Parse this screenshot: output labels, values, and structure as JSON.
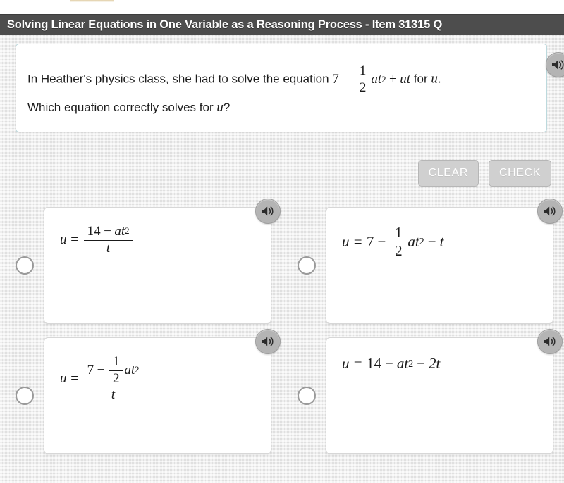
{
  "titlebar": {
    "title": "Solving Linear Equations in One Variable as a Reasoning Process - Item 31315   Q"
  },
  "question": {
    "line1_before": "In Heather's physics class, she had to solve the equation",
    "line1_eq_lhs": "7",
    "line1_eq_rel": "=",
    "line1_frac_num": "1",
    "line1_frac_den": "2",
    "line1_term1": "at",
    "line1_term1_exp": "2",
    "line1_plus": "+",
    "line1_term2": "ut",
    "line1_after": "for",
    "line1_var": "u",
    "line1_period": ".",
    "line2_before": "Which equation correctly solves for",
    "line2_var": "u",
    "line2_after": "?",
    "speaker_icon": "speaker-icon"
  },
  "toolbar": {
    "clear_label": "CLEAR",
    "check_label": "CHECK"
  },
  "options": [
    {
      "id": "option-a",
      "layout": "fraction",
      "lhs": "u",
      "rel": "=",
      "numerator": "14 − at²",
      "num_number": "14",
      "num_op": "−",
      "num_var": "at",
      "num_exp": "2",
      "denominator": "t",
      "plain": "u = (14 − at²)/t",
      "speaker_icon": "speaker-icon",
      "selected": false
    },
    {
      "id": "option-b",
      "layout": "inline",
      "lhs": "u",
      "rel": "=",
      "t1": "7",
      "op1": "−",
      "frac_num": "1",
      "frac_den": "2",
      "t2": "at",
      "t2_exp": "2",
      "op2": "−",
      "t3": "t",
      "plain": "u = 7 − (1/2)at² − t",
      "speaker_icon": "speaker-icon",
      "selected": false
    },
    {
      "id": "option-c",
      "layout": "nested-fraction",
      "lhs": "u",
      "rel": "=",
      "num_t1": "7",
      "num_op": "−",
      "num_frac_num": "1",
      "num_frac_den": "2",
      "num_t2": "at",
      "num_t2_exp": "2",
      "denominator": "t",
      "plain": "u = (7 − (1/2)at²)/t",
      "speaker_icon": "speaker-icon",
      "selected": false
    },
    {
      "id": "option-d",
      "layout": "inline",
      "lhs": "u",
      "rel": "=",
      "t1": "14",
      "op1": "−",
      "t2": "at",
      "t2_exp": "2",
      "op2": "−",
      "t3": "2t",
      "plain": "u = 14 − at² − 2t",
      "speaker_icon": "speaker-icon",
      "selected": false
    }
  ],
  "colors": {
    "titlebar_bg": "#4d4d4d",
    "page_bg": "#e9e9e9",
    "stem_border": "#bcd9dd",
    "card_bg": "#ffffff",
    "button_bg": "#d0d0d0",
    "speaker_bg": "#b4b4b4"
  }
}
